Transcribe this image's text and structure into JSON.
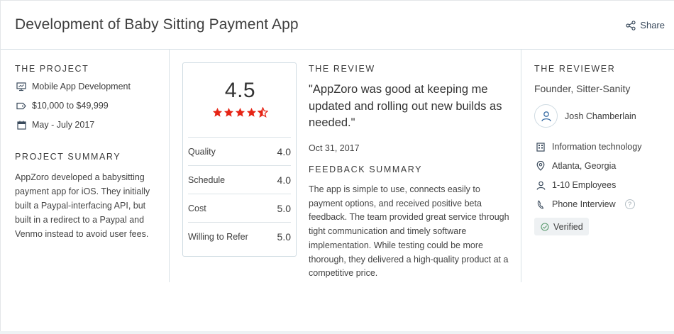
{
  "header": {
    "title": "Development of Baby Sitting Payment App",
    "share_label": "Share"
  },
  "project": {
    "section_title": "THE PROJECT",
    "meta": [
      {
        "icon": "monitor-icon",
        "text": "Mobile App Development"
      },
      {
        "icon": "price-tag-icon",
        "text": "$10,000 to $49,999"
      },
      {
        "icon": "calendar-icon",
        "text": "May - July 2017"
      }
    ],
    "summary_title": "PROJECT SUMMARY",
    "summary_text": "AppZoro developed a babysitting payment app for iOS. They initially built a Paypal-interfacing API, but built in a redirect to a Paypal and Venmo instead to avoid user fees."
  },
  "rating": {
    "overall": "4.5",
    "stars": 4.5,
    "star_color": "#e62415",
    "rows": [
      {
        "label": "Quality",
        "value": "4.0"
      },
      {
        "label": "Schedule",
        "value": "4.0"
      },
      {
        "label": "Cost",
        "value": "5.0"
      },
      {
        "label": "Willing to Refer",
        "value": "5.0"
      }
    ]
  },
  "review": {
    "section_title": "THE REVIEW",
    "quote": "\"AppZoro was good at keeping me updated and rolling out new builds as needed.\"",
    "date": "Oct 31, 2017",
    "feedback_title": "FEEDBACK SUMMARY",
    "feedback_text": "The app is simple to use, connects easily to payment options, and received positive beta feedback. The team provided great service through tight communication and timely software implementation. While testing could be more thorough, they delivered a high-quality product at a competitive price."
  },
  "reviewer": {
    "section_title": "THE REVIEWER",
    "role": "Founder, Sitter-Sanity",
    "name": "Josh Chamberlain",
    "details": [
      {
        "icon": "building-icon",
        "text": "Information technology"
      },
      {
        "icon": "location-pin-icon",
        "text": "Atlanta, Georgia"
      },
      {
        "icon": "person-icon",
        "text": "1-10 Employees"
      },
      {
        "icon": "phone-icon",
        "text": "Phone Interview"
      }
    ],
    "help_glyph": "?",
    "verified_label": "Verified"
  }
}
